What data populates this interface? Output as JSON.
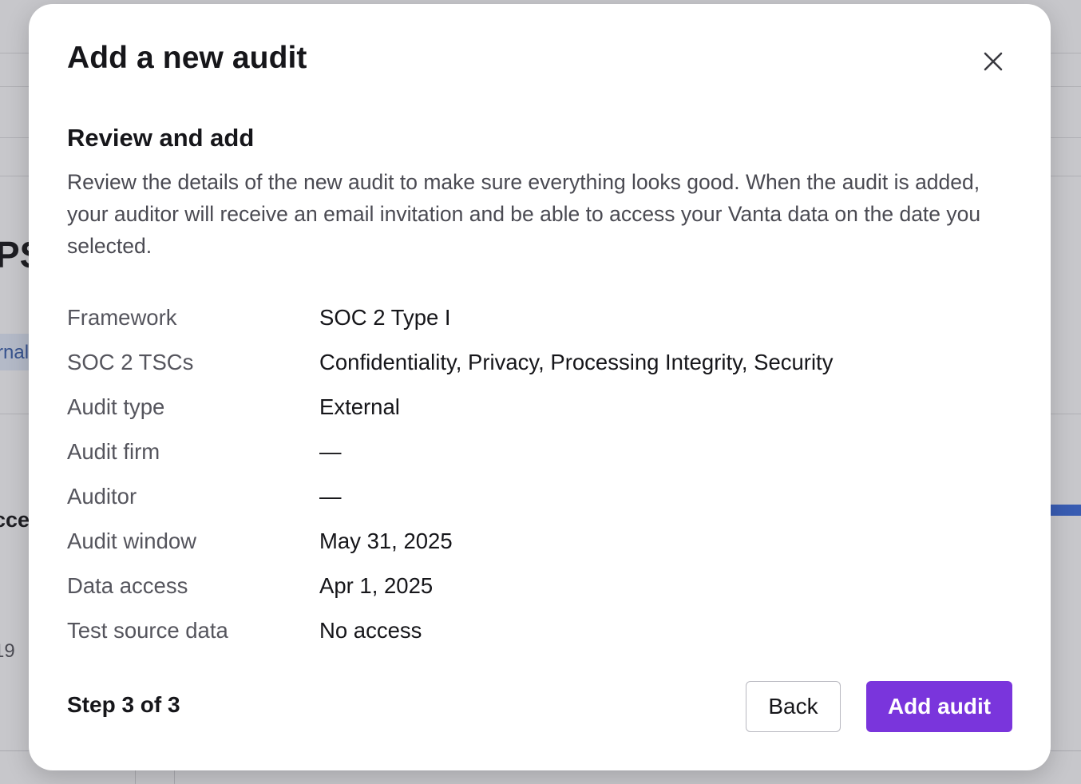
{
  "background": {
    "fragment_heading": "PS",
    "fragment_pill": "rnal",
    "fragment_label": "cce",
    "fragment_number": "19"
  },
  "modal": {
    "title": "Add a new audit",
    "close_icon": "close-icon",
    "section_title": "Review and add",
    "description": "Review the details of the new audit to make sure everything looks good. When the audit is added, your auditor will receive an email invitation and be able to access your Vanta data on the date you selected.",
    "details": [
      {
        "label": "Framework",
        "value": "SOC 2 Type I"
      },
      {
        "label": "SOC 2 TSCs",
        "value": "Confidentiality, Privacy, Processing Integrity, Security"
      },
      {
        "label": "Audit type",
        "value": "External"
      },
      {
        "label": "Audit firm",
        "value": "—"
      },
      {
        "label": "Auditor",
        "value": "—"
      },
      {
        "label": "Audit window",
        "value": "May 31, 2025"
      },
      {
        "label": "Data access",
        "value": "Apr 1, 2025"
      },
      {
        "label": "Test source data",
        "value": "No access"
      }
    ],
    "step": "Step 3 of 3",
    "back_label": "Back",
    "add_label": "Add audit"
  },
  "colors": {
    "accent": "#7a35dc",
    "overlay_bar": "#3d6bd6"
  }
}
